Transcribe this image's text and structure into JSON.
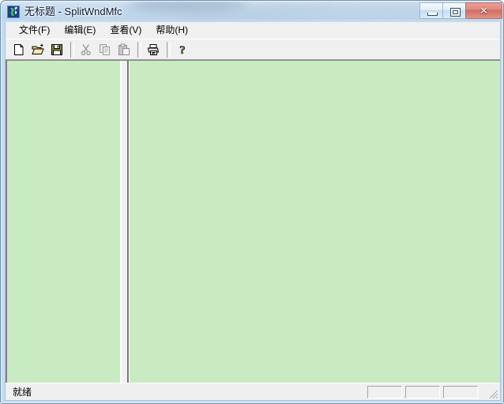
{
  "window": {
    "title": "无标题 - SplitWndMfc",
    "app_icon": "app-icon",
    "controls": {
      "minimize_label": "",
      "maximize_label": "",
      "close_label": "✕"
    }
  },
  "menubar": {
    "items": [
      {
        "label": "文件(F)",
        "name": "menu-file"
      },
      {
        "label": "编辑(E)",
        "name": "menu-edit"
      },
      {
        "label": "查看(V)",
        "name": "menu-view"
      },
      {
        "label": "帮助(H)",
        "name": "menu-help"
      }
    ]
  },
  "toolbar": {
    "buttons": [
      {
        "icon": "new-document-icon",
        "enabled": true
      },
      {
        "icon": "open-folder-icon",
        "enabled": true
      },
      {
        "icon": "save-floppy-icon",
        "enabled": true
      },
      {
        "icon": "separator",
        "enabled": false
      },
      {
        "icon": "cut-scissors-icon",
        "enabled": false
      },
      {
        "icon": "copy-icon",
        "enabled": false
      },
      {
        "icon": "paste-icon",
        "enabled": false
      },
      {
        "icon": "separator",
        "enabled": false
      },
      {
        "icon": "print-icon",
        "enabled": true
      },
      {
        "icon": "separator",
        "enabled": false
      },
      {
        "icon": "help-question-icon",
        "enabled": true
      }
    ]
  },
  "views": {
    "left_pane": {
      "name": "left-view-pane",
      "content": ""
    },
    "right_pane": {
      "name": "right-view-pane",
      "content": ""
    },
    "splitter": {
      "name": "vertical-splitter"
    },
    "pane_background_color": "#c9ebc2"
  },
  "statusbar": {
    "message": "就绪",
    "panes": [
      "",
      "",
      ""
    ]
  },
  "colors": {
    "title_bar_glass": "#c3d8ec",
    "frame_border": "#6b8fae",
    "close_button": "#cf6c60",
    "client_background": "#f0f0f0",
    "view_background": "#c9ebc2"
  }
}
